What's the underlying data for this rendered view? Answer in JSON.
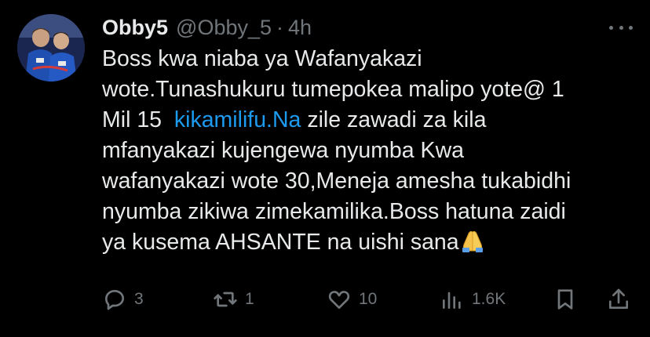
{
  "tweet": {
    "display_name": "Obby5",
    "handle": "@Obby_5",
    "separator": "·",
    "time": "4h",
    "body": {
      "line1": "Boss kwa niaba ya Wafanyakazi",
      "line2": "wote.Tunashukuru tumepokea malipo yote@ 1",
      "line3_prefix": "Mil 15  ",
      "line3_link": "kikamilifu.Na",
      "line3_suffix": " zile zawadi za kila",
      "line4": "mfanyakazi kujengewa nyumba Kwa",
      "line5": "wafanyakazi wote 30,Meneja amesha tukabidhi",
      "line6": "nyumba zikiwa zimekamilika.Boss hatuna zaidi",
      "line7": "ya kusema AHSANTE na uishi sana",
      "emoji": "folded-hands"
    },
    "actions": {
      "replies": "3",
      "retweets": "1",
      "likes": "10",
      "views": "1.6K"
    }
  },
  "colors": {
    "background": "#000000",
    "text_primary": "#e7e9ea",
    "text_secondary": "#71767b",
    "link": "#1d9bf0"
  },
  "icons": [
    "more-icon",
    "reply-icon",
    "retweet-icon",
    "like-icon",
    "views-icon",
    "bookmark-icon",
    "share-icon",
    "folded-hands-emoji"
  ]
}
